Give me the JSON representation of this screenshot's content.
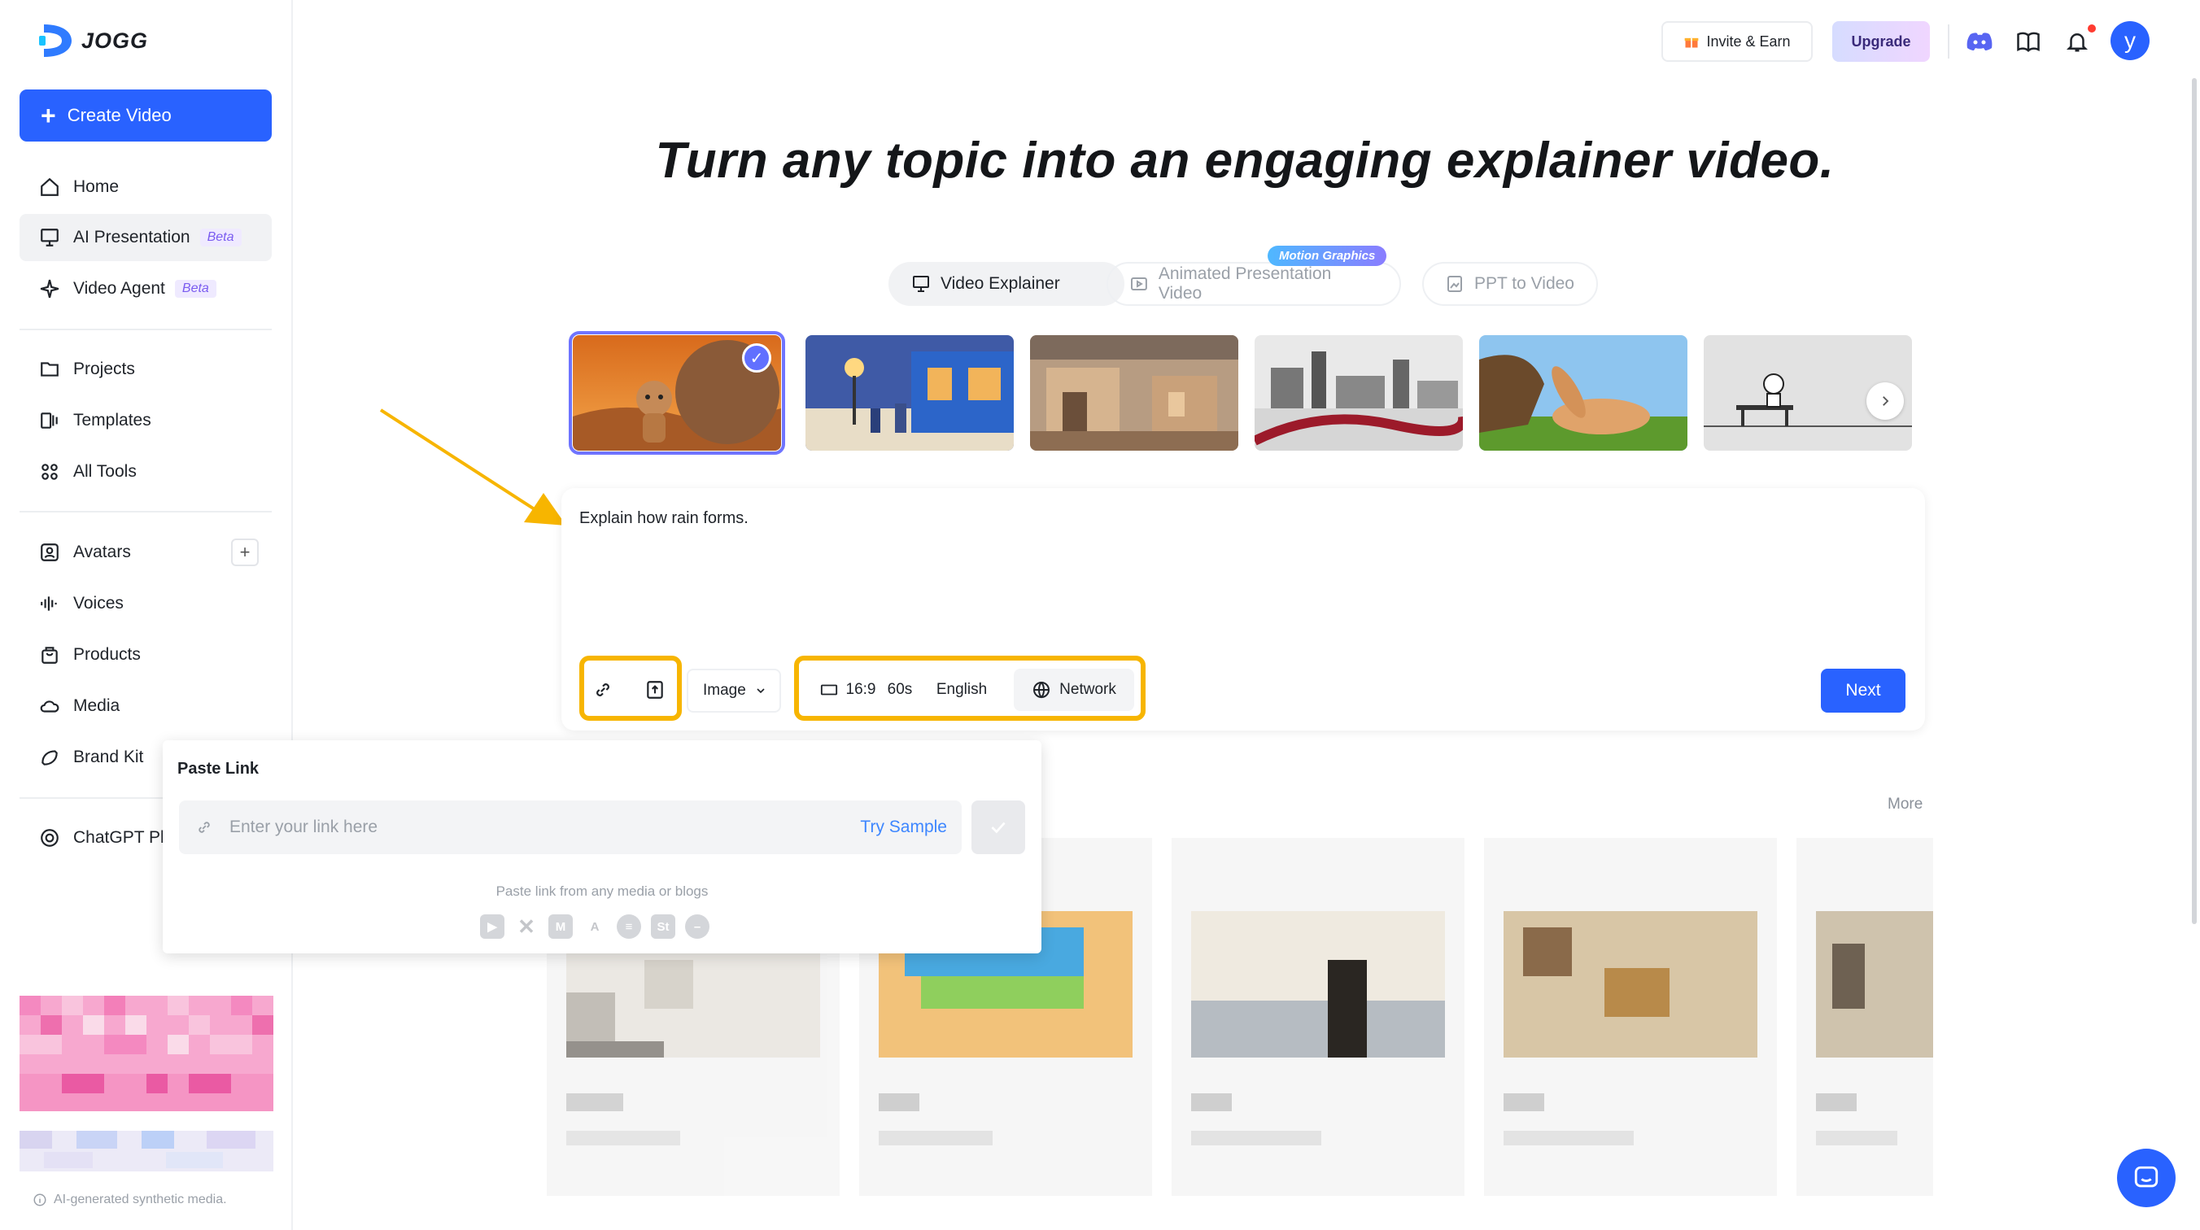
{
  "app": {
    "brand": "JOGG"
  },
  "sidebar": {
    "create_label": "Create Video",
    "items": [
      {
        "label": "Home"
      },
      {
        "label": "AI Presentation",
        "badge": "Beta"
      },
      {
        "label": "Video Agent",
        "badge": "Beta"
      },
      {
        "label": "Projects"
      },
      {
        "label": "Templates"
      },
      {
        "label": "All Tools"
      },
      {
        "label": "Avatars"
      },
      {
        "label": "Voices"
      },
      {
        "label": "Products"
      },
      {
        "label": "Media"
      },
      {
        "label": "Brand Kit"
      },
      {
        "label": "ChatGPT Pl"
      }
    ],
    "disclaimer": "AI-generated synthetic media."
  },
  "header": {
    "invite_label": "Invite & Earn",
    "upgrade_label": "Upgrade",
    "avatar_letter": "y"
  },
  "main": {
    "headline": "Turn any topic into an engaging explainer video.",
    "tabs": [
      {
        "label": "Video Explainer"
      },
      {
        "label": "Animated Presentation Video"
      },
      {
        "label": "PPT to Video"
      }
    ],
    "motion_badge": "Motion Graphics",
    "prompt_text": "Explain how rain forms.",
    "image_select": "Image",
    "ratio": "16:9",
    "duration": "60s",
    "language": "English",
    "network_label": "Network",
    "next_label": "Next",
    "more_label": "More"
  },
  "popup": {
    "title": "Paste Link",
    "placeholder": "Enter your link here",
    "try_sample": "Try Sample",
    "hint": "Paste link from any media or blogs"
  },
  "colors": {
    "accent": "#2962ff",
    "highlight": "#f7b500",
    "beta": "#7a5cf0"
  }
}
